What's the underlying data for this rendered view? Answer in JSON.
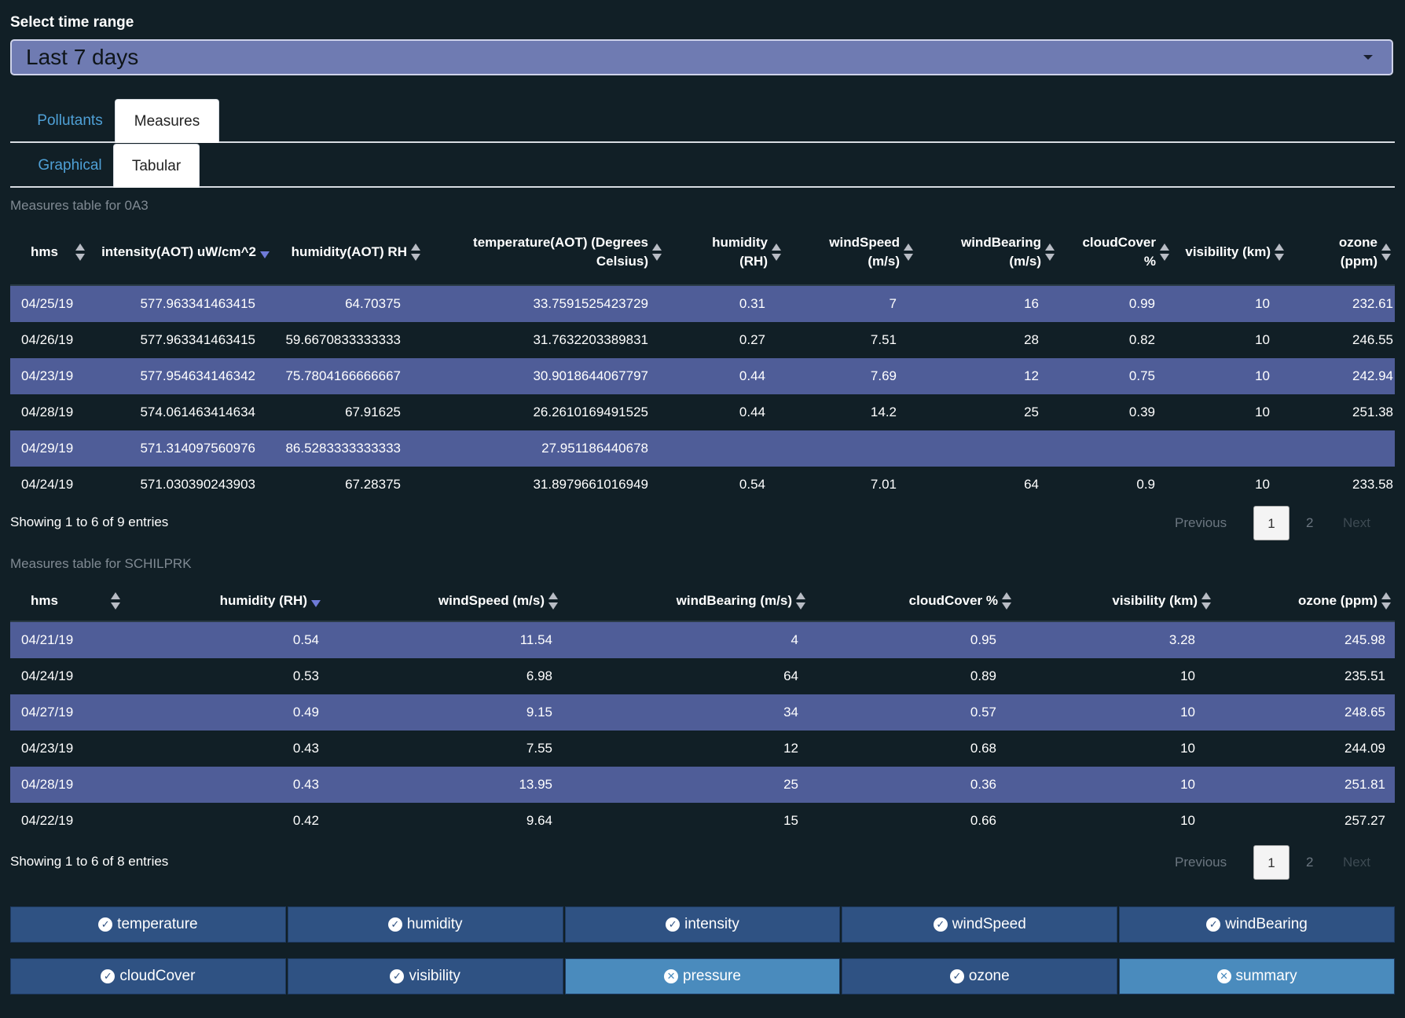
{
  "time_range": {
    "label": "Select time range",
    "value": "Last 7 days"
  },
  "main_tabs": [
    {
      "label": "Pollutants"
    },
    {
      "label": "Measures"
    }
  ],
  "sub_tabs": [
    {
      "label": "Graphical"
    },
    {
      "label": "Tabular"
    }
  ],
  "table1": {
    "title": "Measures table for 0A3",
    "columns": [
      "hms",
      "intensity(AOT) uW/cm^2",
      "humidity(AOT) RH",
      "temperature(AOT) (Degrees Celsius)",
      "humidity (RH)",
      "windSpeed (m/s)",
      "windBearing (m/s)",
      "cloudCover %",
      "visibility (km)",
      "ozone (ppm)"
    ],
    "rows": [
      [
        "04/25/19",
        "577.963341463415",
        "64.70375",
        "33.7591525423729",
        "0.31",
        "7",
        "16",
        "0.99",
        "10",
        "232.61"
      ],
      [
        "04/26/19",
        "577.963341463415",
        "59.6670833333333",
        "31.7632203389831",
        "0.27",
        "7.51",
        "28",
        "0.82",
        "10",
        "246.55"
      ],
      [
        "04/23/19",
        "577.954634146342",
        "75.7804166666667",
        "30.9018644067797",
        "0.44",
        "7.69",
        "12",
        "0.75",
        "10",
        "242.94"
      ],
      [
        "04/28/19",
        "574.061463414634",
        "67.91625",
        "26.2610169491525",
        "0.44",
        "14.2",
        "25",
        "0.39",
        "10",
        "251.38"
      ],
      [
        "04/29/19",
        "571.314097560976",
        "86.5283333333333",
        "27.951186440678",
        "",
        "",
        "",
        "",
        "",
        ""
      ],
      [
        "04/24/19",
        "571.030390243903",
        "67.28375",
        "31.8979661016949",
        "0.54",
        "7.01",
        "64",
        "0.9",
        "10",
        "233.58"
      ]
    ],
    "info": "Showing 1 to 6 of 9 entries",
    "pagination": {
      "previous": "Previous",
      "pages": [
        "1",
        "2"
      ],
      "next": "Next"
    }
  },
  "table2": {
    "title": "Measures table for SCHILPRK",
    "columns": [
      "hms",
      "humidity (RH)",
      "windSpeed (m/s)",
      "windBearing (m/s)",
      "cloudCover %",
      "visibility (km)",
      "ozone (ppm)"
    ],
    "rows": [
      [
        "04/21/19",
        "0.54",
        "11.54",
        "4",
        "0.95",
        "3.28",
        "245.98"
      ],
      [
        "04/24/19",
        "0.53",
        "6.98",
        "64",
        "0.89",
        "10",
        "235.51"
      ],
      [
        "04/27/19",
        "0.49",
        "9.15",
        "34",
        "0.57",
        "10",
        "248.65"
      ],
      [
        "04/23/19",
        "0.43",
        "7.55",
        "12",
        "0.68",
        "10",
        "244.09"
      ],
      [
        "04/28/19",
        "0.43",
        "13.95",
        "25",
        "0.36",
        "10",
        "251.81"
      ],
      [
        "04/22/19",
        "0.42",
        "9.64",
        "15",
        "0.66",
        "10",
        "257.27"
      ]
    ],
    "info": "Showing 1 to 6 of 8 entries",
    "pagination": {
      "previous": "Previous",
      "pages": [
        "1",
        "2"
      ],
      "next": "Next"
    }
  },
  "toggles_row1": [
    {
      "label": "temperature",
      "icon": "check-circle-icon"
    },
    {
      "label": "humidity",
      "icon": "check-circle-icon"
    },
    {
      "label": "intensity",
      "icon": "check-circle-icon"
    },
    {
      "label": "windSpeed",
      "icon": "check-circle-icon"
    },
    {
      "label": "windBearing",
      "icon": "check-circle-icon"
    }
  ],
  "toggles_row2": [
    {
      "label": "cloudCover",
      "icon": "check-circle-icon"
    },
    {
      "label": "visibility",
      "icon": "check-circle-icon"
    },
    {
      "label": "pressure",
      "icon": "x-circle-icon"
    },
    {
      "label": "ozone",
      "icon": "check-circle-icon"
    },
    {
      "label": "summary",
      "icon": "x-circle-icon"
    }
  ],
  "colors": {
    "background": "#111f26",
    "odd_row": "#4f5d98",
    "select_bg": "#6f7bb2",
    "toggle_on": "#2f5283",
    "toggle_off": "#4a8bbd",
    "tab_link": "#4fa0d6"
  }
}
